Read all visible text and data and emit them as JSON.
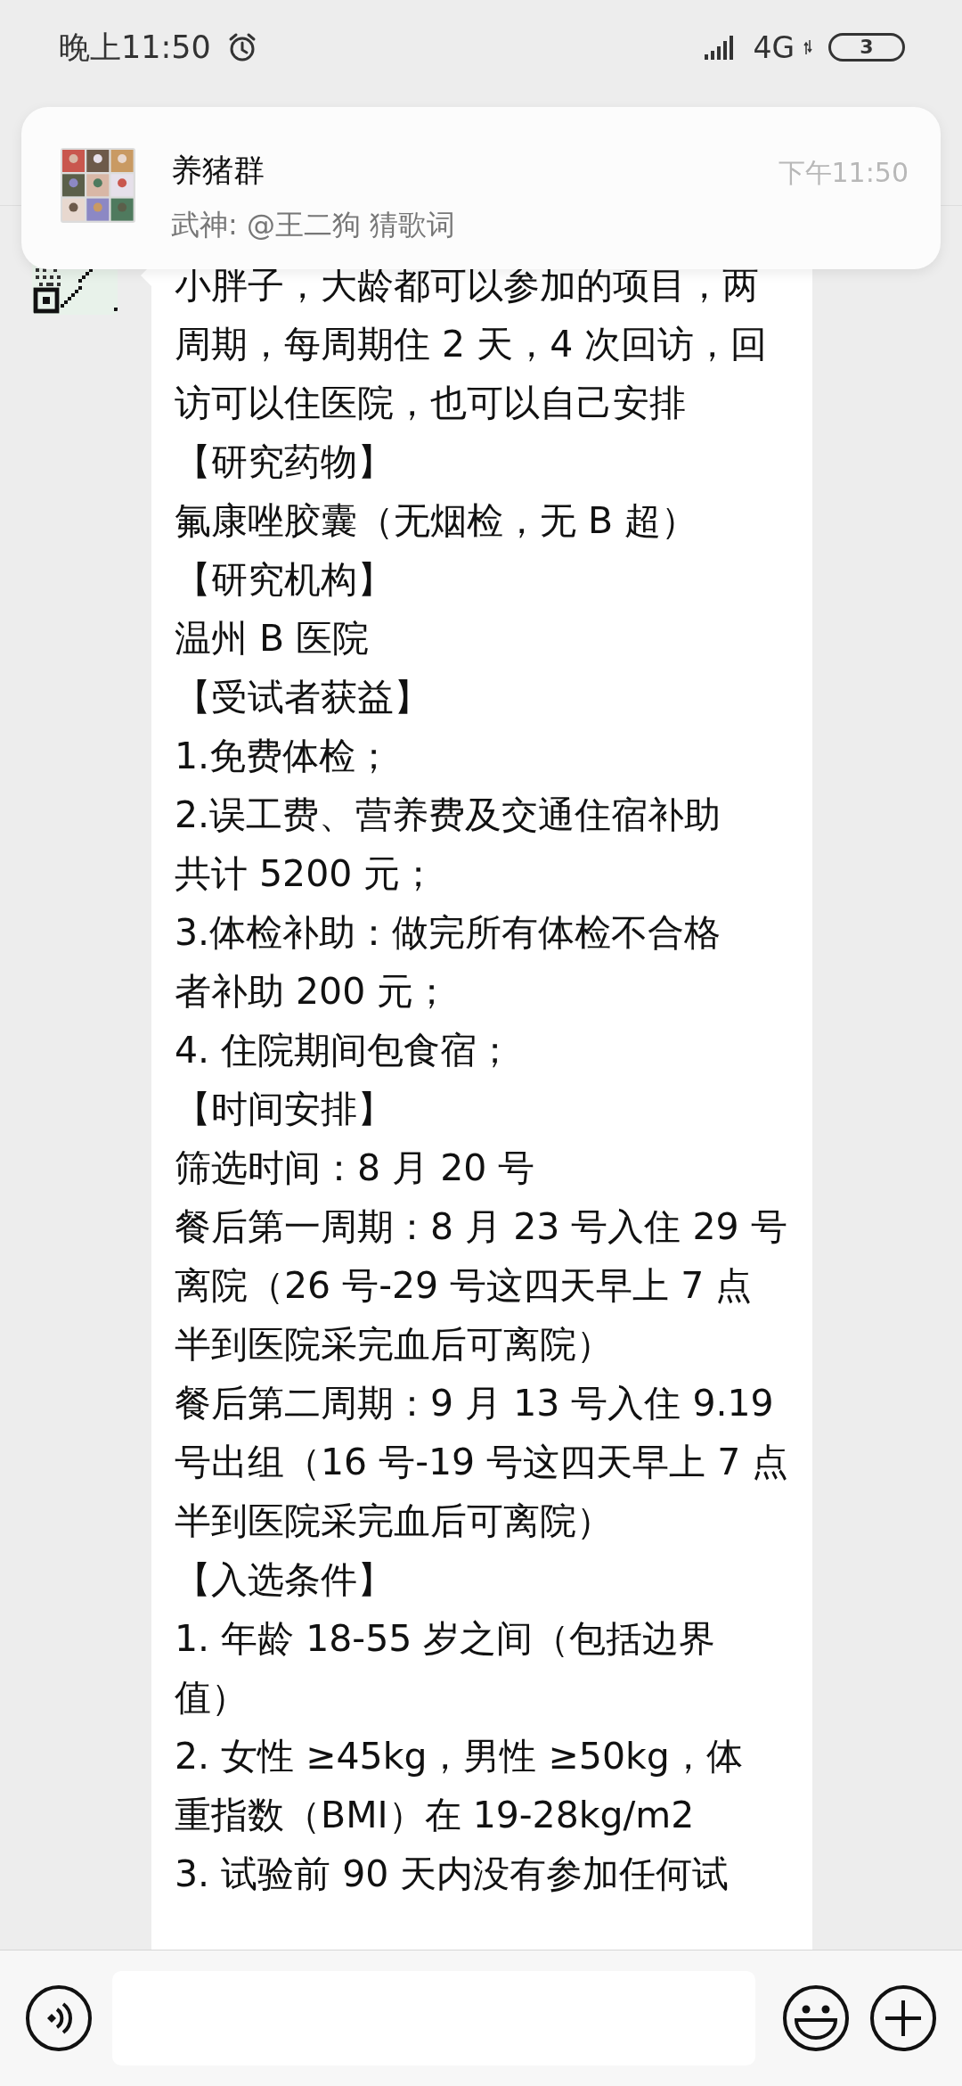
{
  "status_bar": {
    "time": "晚上11:50",
    "network": "4G",
    "battery": "3"
  },
  "notification": {
    "title": "养猪群",
    "message": "武神: @王二狗 猜歌词",
    "time": "下午11:50"
  },
  "messages": [
    {
      "lines": [
        "小胖子，大龄都可以参加的项目，两",
        "周期，每周期住 2 天，4 次回访，回",
        "访可以住医院，也可以自己安排",
        "【研究药物】",
        "氟康唑胶囊（无烟检，无 B 超）",
        "【研究机构】",
        "温州 B 医院",
        "【受试者获益】",
        "1.免费体检；",
        "2.误工费、营养费及交通住宿补助",
        "共计 5200 元；",
        "3.体检补助：做完所有体检不合格",
        "者补助 200 元；",
        "4. 住院期间包食宿；",
        "【时间安排】",
        "筛选时间：8 月 20 号",
        "餐后第一周期：8 月 23 号入住 29 号",
        "离院（26 号-29 号这四天早上 7 点",
        "半到医院采完血后可离院）",
        "餐后第二周期：9 月 13 号入住 9.19",
        "号出组（16 号-19 号这四天早上 7 点",
        "半到医院采完血后可离院）",
        "【入选条件】",
        "1. 年龄 18-55 岁之间（包括边界",
        "值）",
        "2.  女性 ≥45kg，男性 ≥50kg，体",
        "重指数（BMI）在 19-28kg/m2",
        "3. 试验前 90 天内没有参加任何试"
      ]
    }
  ]
}
